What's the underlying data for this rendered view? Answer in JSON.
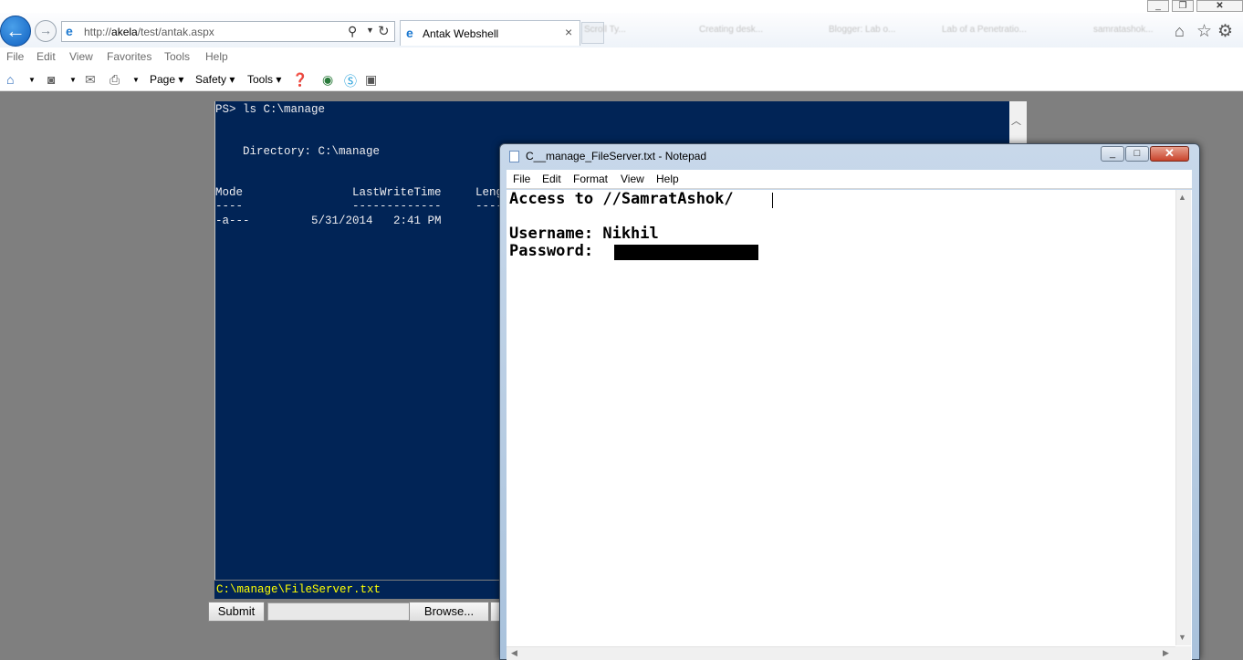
{
  "browser": {
    "address_prefix": "http://",
    "address_host": "akela",
    "address_path": "/test/antak.aspx",
    "active_tab_title": "Antak Webshell",
    "ghost_tabs": [
      "Scroll Ty...",
      "Creating desk...",
      "Blogger: Lab o...",
      "Lab of a Penetratio...",
      "samratashok..."
    ],
    "menu": [
      "File",
      "Edit",
      "View",
      "Favorites",
      "Tools",
      "Help"
    ],
    "command_bar": {
      "page": "Page",
      "safety": "Safety",
      "tools": "Tools"
    }
  },
  "console": {
    "lines": [
      "PS> ls C:\\manage",
      "",
      "",
      "    Directory: C:\\manage",
      "",
      "",
      "Mode                LastWriteTime     Length",
      "----                -------------     ------",
      "-a---         5/31/2014   2:41 PM"
    ],
    "command_input": "C:\\manage\\FileServer.txt",
    "submit_label": "Submit",
    "browse_label": "Browse..."
  },
  "notepad": {
    "title": "C__manage_FileServer.txt - Notepad",
    "menu": [
      "File",
      "Edit",
      "Format",
      "View",
      "Help"
    ],
    "content_lines": [
      "Access to //SamratAshok/",
      "",
      "Username: Nikhil",
      "Password: "
    ]
  },
  "colors": {
    "console_bg": "#012456",
    "console_input_text": "#ffff00",
    "page_bg": "#7f7f7f",
    "close_button": "#c8432b"
  }
}
